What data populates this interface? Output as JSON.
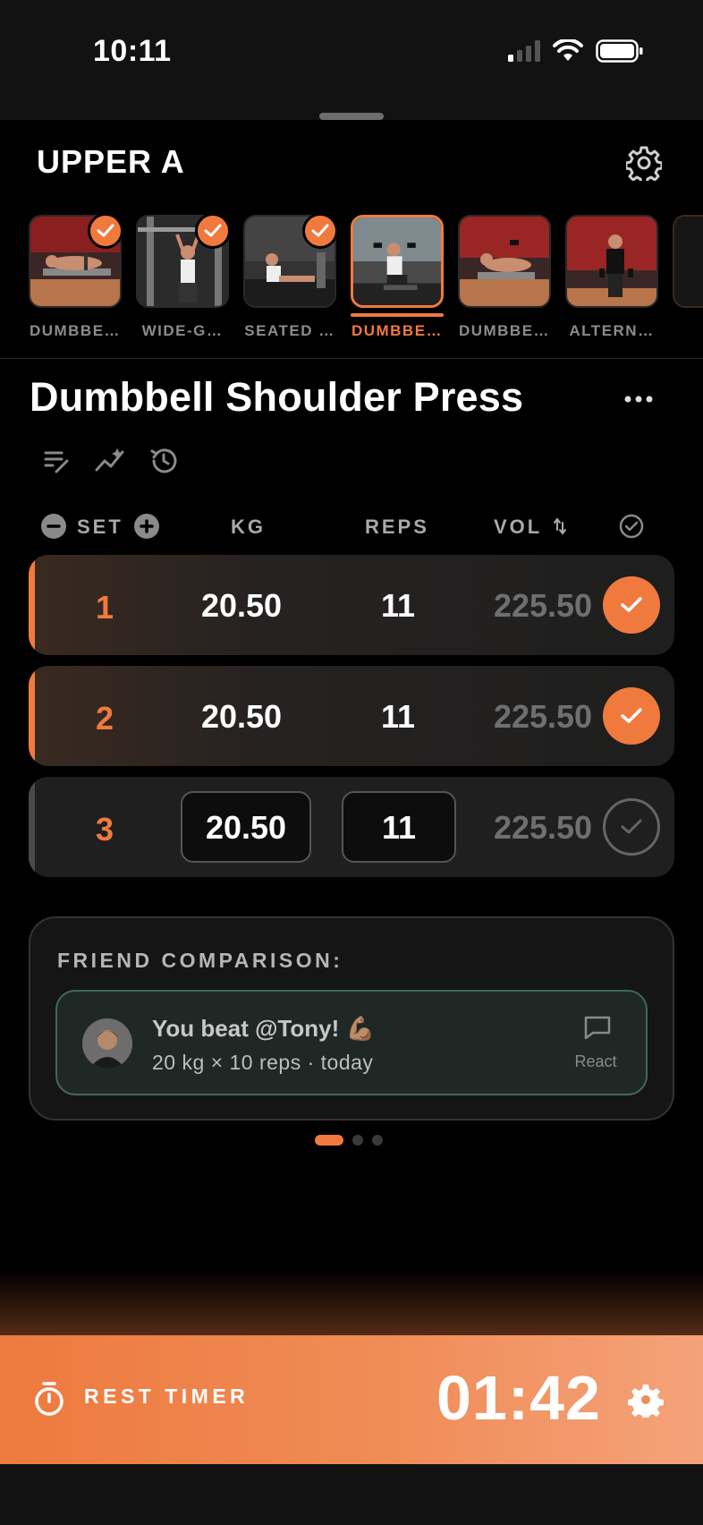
{
  "status_bar": {
    "time": "10:11"
  },
  "workout": {
    "title": "UPPER A"
  },
  "exercises": [
    {
      "label": "DUMBBE…",
      "completed": true,
      "active": false
    },
    {
      "label": "WIDE-G…",
      "completed": true,
      "active": false
    },
    {
      "label": "SEATED …",
      "completed": true,
      "active": false
    },
    {
      "label": "DUMBBE…",
      "completed": false,
      "active": true
    },
    {
      "label": "DUMBBE…",
      "completed": false,
      "active": false
    },
    {
      "label": "ALTERN…",
      "completed": false,
      "active": false
    }
  ],
  "exercise": {
    "title": "Dumbbell Shoulder Press"
  },
  "table": {
    "headers": {
      "set": "SET",
      "kg": "KG",
      "reps": "REPS",
      "vol": "VOL"
    },
    "rows": [
      {
        "set": "1",
        "kg": "20.50",
        "reps": "11",
        "vol": "225.50",
        "done": true
      },
      {
        "set": "2",
        "kg": "20.50",
        "reps": "11",
        "vol": "225.50",
        "done": true
      },
      {
        "set": "3",
        "kg": "20.50",
        "reps": "11",
        "vol": "225.50",
        "done": false
      }
    ]
  },
  "friend_comparison": {
    "title": "FRIEND COMPARISON:",
    "message": "You beat @Tony! 💪🏽",
    "detail": "20 kg × 10 reps · today",
    "react_label": "React"
  },
  "pager": {
    "count": 3,
    "active_index": 0
  },
  "rest_timer": {
    "label": "REST TIMER",
    "time": "01:42"
  },
  "colors": {
    "accent": "#f07a3e",
    "background": "#000000",
    "success_border": "#3f6b52"
  }
}
